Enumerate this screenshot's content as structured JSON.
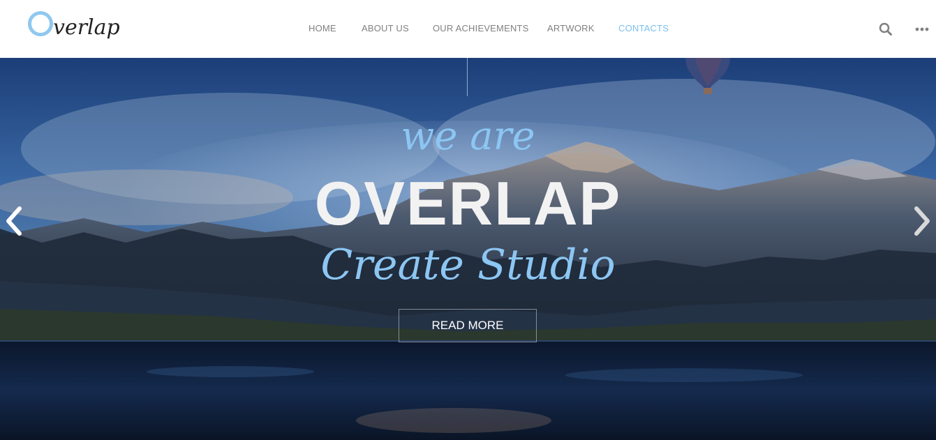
{
  "header": {
    "logo_text": "verlap",
    "nav": [
      {
        "label": "HOME",
        "active": false
      },
      {
        "label": "ABOUT US",
        "active": false
      },
      {
        "label": "OUR ACHIEVEMENTS",
        "active": false
      },
      {
        "label": "ARTWORK",
        "active": false
      },
      {
        "label": "CONTACTS",
        "active": true
      }
    ],
    "icons": [
      "search-icon",
      "more-icon"
    ]
  },
  "hero": {
    "kicker": "we are",
    "title": "OVERLAP",
    "subtitle": "Create Studio",
    "cta_label": "READ MORE",
    "arrows": [
      "chevron-left-icon",
      "chevron-right-icon"
    ]
  },
  "colors": {
    "accent": "#7cc0ec",
    "nav_text": "#808080",
    "title_text": "#f2f2f2"
  }
}
